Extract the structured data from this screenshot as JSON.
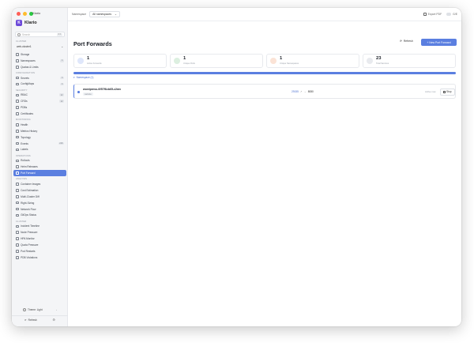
{
  "window": {
    "title": "Klario"
  },
  "brand": {
    "logo_letter": "K",
    "name": "Klario"
  },
  "search": {
    "placeholder": "Search",
    "shortcut": "⌘K"
  },
  "cluster": {
    "label": "CLUSTER",
    "value": "web-cluster1"
  },
  "sidebar": {
    "sections": [
      {
        "items": [
          {
            "label": "Storage",
            "icon": "storage-icon"
          },
          {
            "label": "Namespaces",
            "icon": "namespace-icon",
            "count": "4"
          },
          {
            "label": "Quotas & Limits",
            "icon": "quota-icon"
          }
        ]
      },
      {
        "header": "Configuration",
        "items": [
          {
            "label": "Secrets",
            "icon": "secret-icon",
            "count": "3"
          },
          {
            "label": "ConfigMaps",
            "icon": "configmap-icon",
            "count": "4"
          }
        ]
      },
      {
        "header": "Security",
        "items": [
          {
            "label": "RBAC",
            "icon": "rbac-icon",
            "count": "12"
          },
          {
            "label": "CRDs",
            "icon": "crd-icon",
            "count": "12"
          },
          {
            "label": "PDBs",
            "icon": "pdb-icon"
          },
          {
            "label": "Certificates",
            "icon": "certificate-icon"
          }
        ]
      },
      {
        "header": "Monitoring",
        "items": [
          {
            "label": "Health",
            "icon": "health-icon"
          },
          {
            "label": "Metrics History",
            "icon": "metrics-icon"
          },
          {
            "label": "Topology",
            "icon": "topology-icon"
          },
          {
            "label": "Events",
            "icon": "events-icon",
            "count": "218"
          },
          {
            "label": "Labels",
            "icon": "labels-icon"
          }
        ]
      },
      {
        "header": "Operations",
        "items": [
          {
            "label": "Rollouts",
            "icon": "rollouts-icon"
          },
          {
            "label": "Helm Releases",
            "icon": "helm-icon"
          },
          {
            "label": "Port Forward",
            "icon": "port-forward-icon",
            "active": true
          }
        ]
      },
      {
        "header": "Analysis",
        "items": [
          {
            "label": "Container Images",
            "icon": "images-icon"
          },
          {
            "label": "Cost Estimation",
            "icon": "cost-icon"
          },
          {
            "label": "Multi-Cluster Diff",
            "icon": "diff-icon"
          },
          {
            "label": "Right-Sizing",
            "icon": "right-sizing-icon"
          },
          {
            "label": "Network Flow",
            "icon": "network-icon"
          },
          {
            "label": "GitOps Status",
            "icon": "gitops-icon"
          }
        ]
      },
      {
        "header": "Cluster",
        "items": [
          {
            "label": "Incident Timeline",
            "icon": "timeline-icon"
          },
          {
            "label": "Node Pressure",
            "icon": "pressure-icon"
          },
          {
            "label": "HPA Monitor",
            "icon": "hpa-icon"
          },
          {
            "label": "Quota Pressure",
            "icon": "quota-pressure-icon"
          },
          {
            "label": "Pod Restarts",
            "icon": "restart-icon"
          },
          {
            "label": "PDB Violations",
            "icon": "pdb-violation-icon"
          }
        ]
      }
    ]
  },
  "theme": {
    "label": "Theme: Light"
  },
  "footer": {
    "label": "Refresh"
  },
  "topbar": {
    "namespace_label": "Namespace",
    "namespace_value": "All namespaces",
    "export_label": "Export PDF",
    "context_label": "G/E"
  },
  "page": {
    "title": "Port Forwards",
    "refresh_label": "Refresh",
    "new_label": "+ New Port Forward"
  },
  "stats": [
    {
      "value": "1",
      "label": "Active Forwards",
      "color": "#dfe7fb"
    },
    {
      "value": "1",
      "label": "Unique Pods",
      "color": "#dcefe0"
    },
    {
      "value": "1",
      "label": "Unique Namespaces",
      "color": "#fbe3d6"
    },
    {
      "value": "23",
      "label": "Total Services",
      "color": "#e8eaee"
    }
  ],
  "progress": {
    "fraction": 1.0,
    "color": "#5b7fe0"
  },
  "group": {
    "label": "Namespace (1)"
  },
  "forwards": [
    {
      "name": "wordpress-6f57f6cb65-z2mv",
      "namespace": "website",
      "local_port": "29155",
      "remote_port": "8080",
      "status": "Active now",
      "stop_label": "Stop"
    }
  ]
}
